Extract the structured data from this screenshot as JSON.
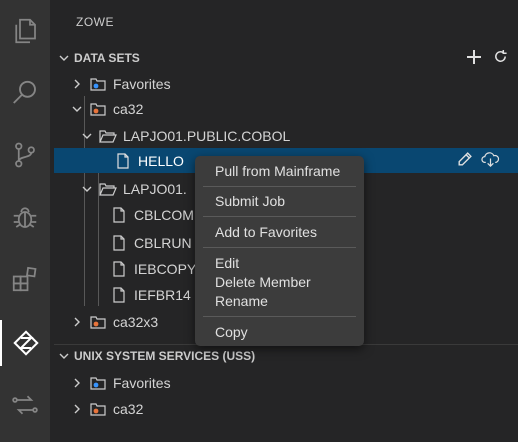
{
  "sidebar": {
    "title": "ZOWE"
  },
  "data_sets": {
    "header": "DATA SETS",
    "tree": {
      "favorites": "Favorites",
      "profile": "ca32",
      "pds1": "LAPJO01.PUBLIC.COBOL",
      "member_selected": "HELLO",
      "pds2": "LAPJO01.",
      "members": [
        "CBLCOM",
        "CBLRUN",
        "IEBCOPY",
        "IEFBR14"
      ],
      "profile2": "ca32x3"
    }
  },
  "uss": {
    "header": "UNIX SYSTEM SERVICES (USS)",
    "tree": {
      "favorites": "Favorites",
      "profile": "ca32"
    }
  },
  "context_menu": {
    "pull": "Pull from Mainframe",
    "submit": "Submit Job",
    "add_fav": "Add to Favorites",
    "edit": "Edit",
    "delete": "Delete Member",
    "rename": "Rename",
    "copy": "Copy"
  },
  "colors": {
    "selected_row": "#094771",
    "sidebar_bg": "#252526",
    "activity_bg": "#333333"
  },
  "icons": {
    "activity": [
      "explorer-icon",
      "search-icon",
      "source-control-icon",
      "debug-icon",
      "extensions-icon",
      "zowe-icon",
      "remote-icon"
    ],
    "actions": [
      "add-icon",
      "refresh-icon",
      "edit-pencil-icon",
      "cloud-download-icon"
    ]
  }
}
